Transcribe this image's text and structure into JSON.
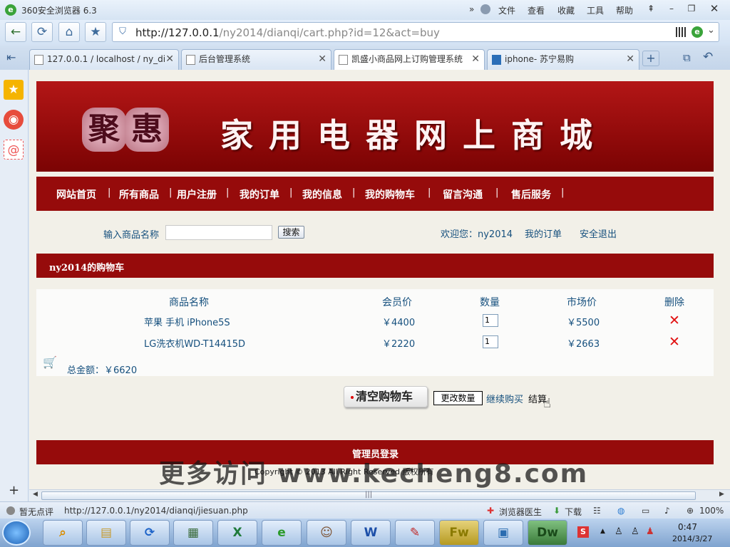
{
  "browser": {
    "title": "360安全浏览器 6.3",
    "menu": [
      "文件",
      "查看",
      "收藏",
      "工具",
      "帮助"
    ],
    "url_host": "http://127.0.0.1",
    "url_path": "/ny2014/dianqi/cart.php?id=12&act=buy",
    "tabs": [
      {
        "label": "127.0.0.1 / localhost / ny_di"
      },
      {
        "label": "后台管理系统"
      },
      {
        "label": "凯盛小商品网上订购管理系统"
      },
      {
        "label": "iphone- 苏宁易购"
      }
    ],
    "status_rating": "暂无点评",
    "status_url": "http://127.0.0.1/ny2014/dianqi/jiesuan.php",
    "status_doctor": "浏览器医生",
    "status_download": "下载",
    "zoom": "100%"
  },
  "site": {
    "seal": [
      "聚",
      "惠"
    ],
    "banner_title": "家用电器网上商城",
    "nav": [
      "网站首页",
      "所有商品",
      "用户注册",
      "我的订单",
      "我的信息",
      "我的购物车",
      "留言沟通",
      "售后服务"
    ],
    "search_label": "输入商品名称",
    "search_value": "",
    "search_button": "搜索",
    "welcome": "欢迎您：ny2014",
    "my_orders": "我的订单",
    "logout": "安全退出"
  },
  "cart": {
    "heading": "ny2014的购物车",
    "columns": [
      "商品名称",
      "会员价",
      "数量",
      "市场价",
      "删除"
    ],
    "rows": [
      {
        "name": "苹果 手机 iPhone5S",
        "member_price": "￥4400",
        "qty": "1",
        "market_price": "￥5500"
      },
      {
        "name": "LG洗衣机WD-T14415D",
        "member_price": "￥2220",
        "qty": "1",
        "market_price": "￥2663"
      }
    ],
    "total": "总金额：￥6620",
    "clear_button": "清空购物车",
    "update_button": "更改数量",
    "continue_link": "继续购买",
    "checkout_link": "结算"
  },
  "footer": {
    "admin_login": "管理员登录",
    "copyright": "Copyright © 2013 All Right Reserved 版权所有",
    "watermark": "更多访问 www.kecheng8.com"
  },
  "taskbar": {
    "time": "0:47",
    "date": "2014/3/27"
  }
}
